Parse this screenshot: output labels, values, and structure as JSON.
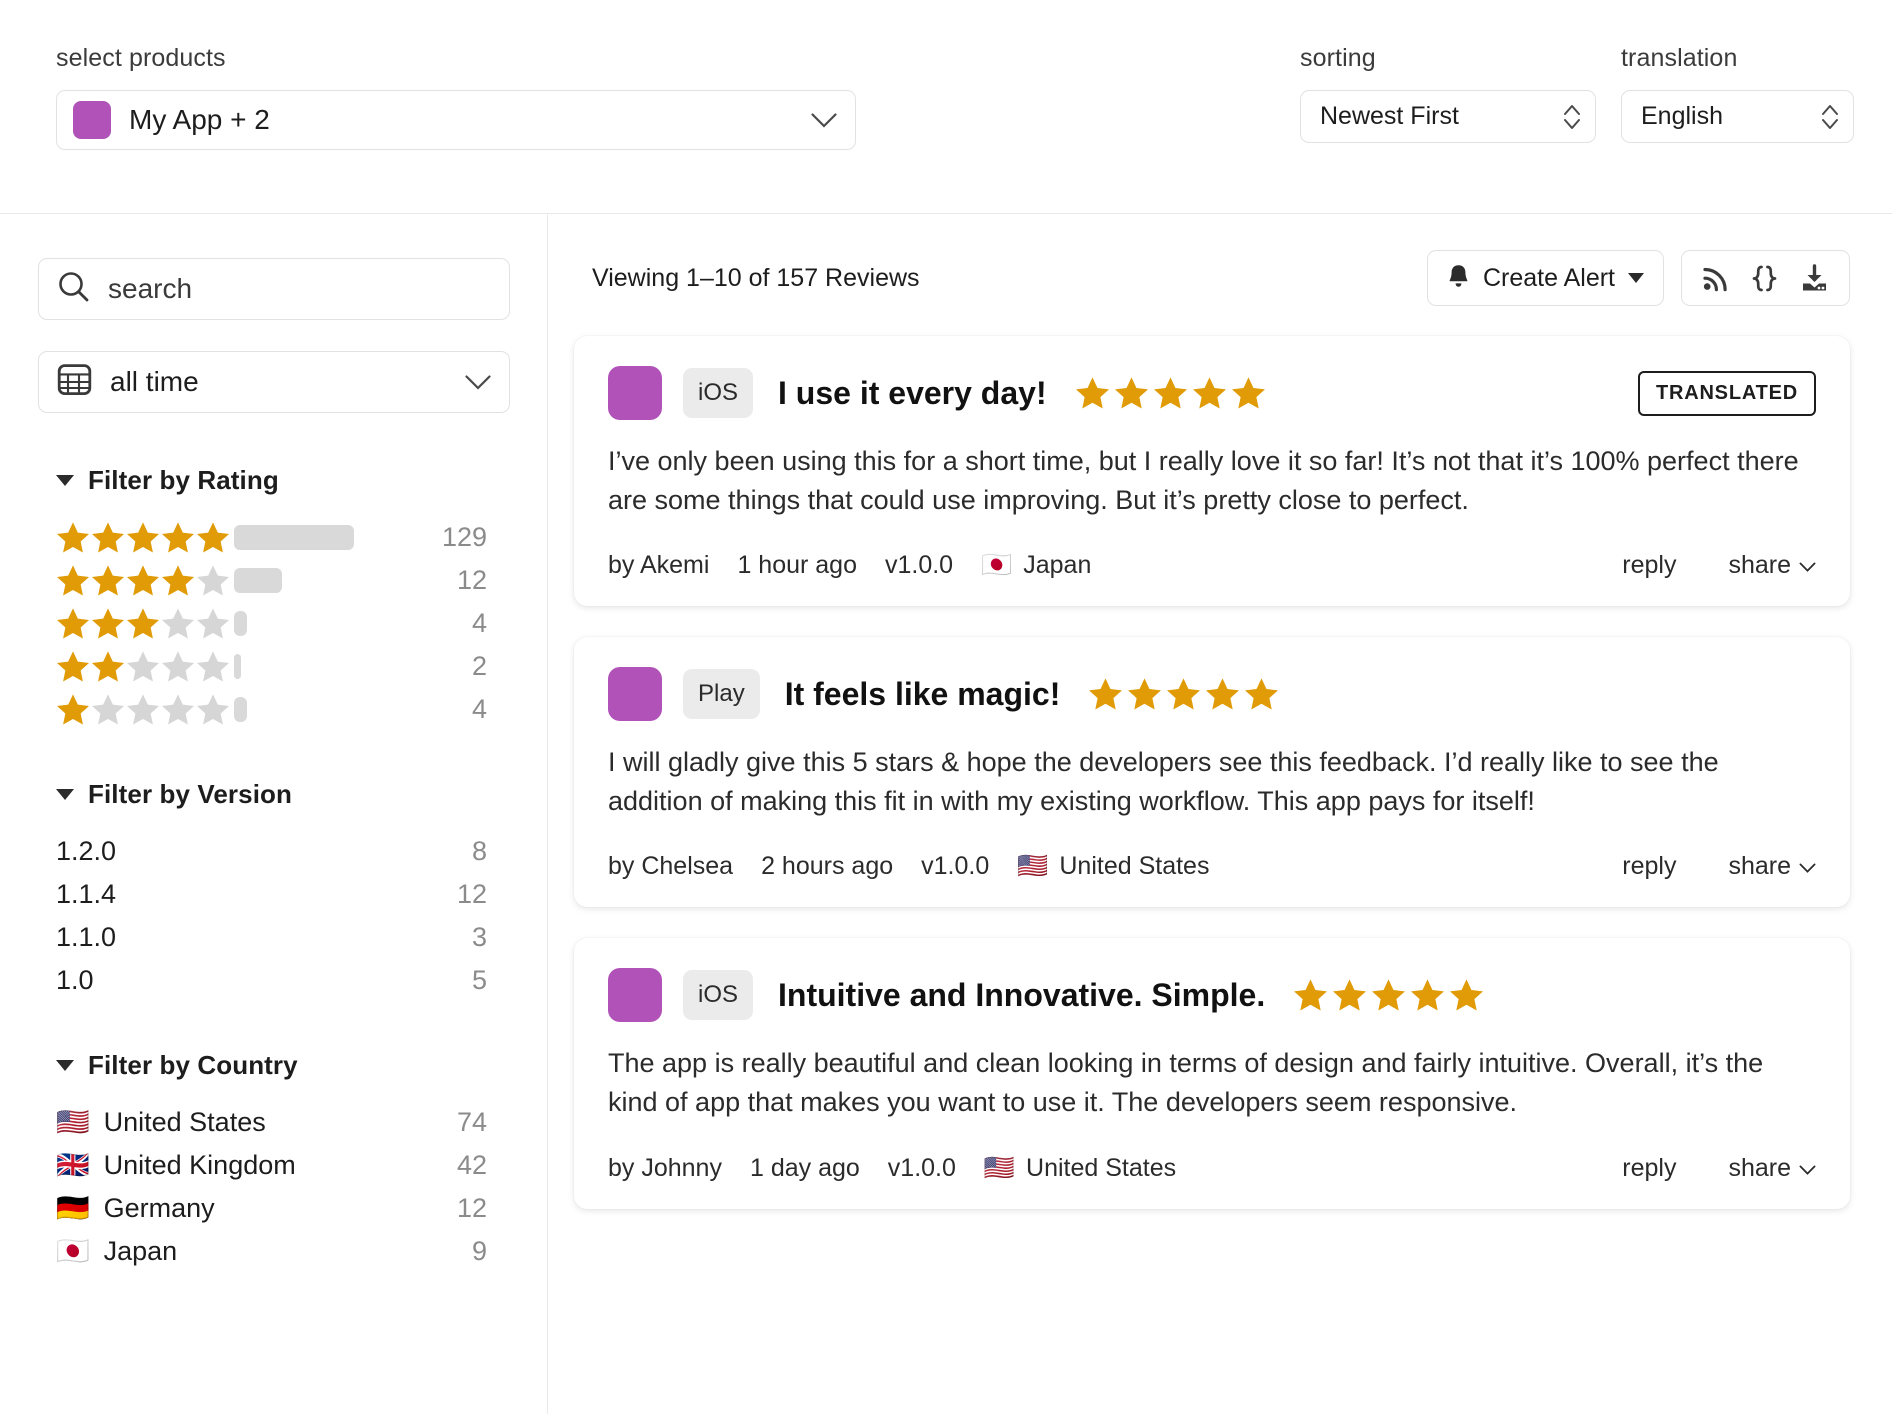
{
  "header": {
    "products_label": "select products",
    "product_value": "My App + 2",
    "sorting_label": "sorting",
    "sorting_value": "Newest First",
    "translation_label": "translation",
    "translation_value": "English"
  },
  "sidebar": {
    "search_placeholder": "search",
    "search_value": "",
    "time_value": "all time",
    "rating_filter": {
      "title": "Filter by Rating",
      "rows": [
        {
          "stars": 5,
          "count": "129",
          "bar_pct": 100
        },
        {
          "stars": 4,
          "count": "12",
          "bar_pct": 40
        },
        {
          "stars": 3,
          "count": "4",
          "bar_pct": 11
        },
        {
          "stars": 2,
          "count": "2",
          "bar_pct": 6
        },
        {
          "stars": 1,
          "count": "4",
          "bar_pct": 11
        }
      ]
    },
    "version_filter": {
      "title": "Filter by Version",
      "rows": [
        {
          "label": "1.2.0",
          "count": "8"
        },
        {
          "label": "1.1.4",
          "count": "12"
        },
        {
          "label": "1.1.0",
          "count": "3"
        },
        {
          "label": "1.0",
          "count": "5"
        }
      ]
    },
    "country_filter": {
      "title": "Filter by Country",
      "rows": [
        {
          "flag": "🇺🇸",
          "label": "United States",
          "count": "74"
        },
        {
          "flag": "🇬🇧",
          "label": "United Kingdom",
          "count": "42"
        },
        {
          "flag": "🇩🇪",
          "label": "Germany",
          "count": "12"
        },
        {
          "flag": "🇯🇵",
          "label": "Japan",
          "count": "9"
        }
      ]
    }
  },
  "main": {
    "viewing_text": "Viewing 1–10 of 157 Reviews",
    "create_alert_label": "Create Alert",
    "reply_label": "reply",
    "share_label": "share",
    "translated_label": "TRANSLATED"
  },
  "reviews": [
    {
      "platform": "iOS",
      "title": "I use it every day!",
      "rating": 5,
      "translated": true,
      "body": "I’ve only been using this for a short time, but I really love it so far! It’s not that it’s 100% perfect there are some things that could use improving. But it’s pretty close to perfect.",
      "author": "by Akemi",
      "time": "1 hour ago",
      "version": "v1.0.0",
      "flag": "🇯🇵",
      "country": "Japan"
    },
    {
      "platform": "Play",
      "title": "It feels like magic!",
      "rating": 5,
      "translated": false,
      "body": "I will gladly give this 5 stars & hope the developers see this feedback. I’d really like to see the addition of making this fit in with my existing workflow. This app pays for itself!",
      "author": "by Chelsea",
      "time": "2 hours ago",
      "version": "v1.0.0",
      "flag": "🇺🇸",
      "country": "United States"
    },
    {
      "platform": "iOS",
      "title": "Intuitive and Innovative. Simple.",
      "rating": 5,
      "translated": false,
      "body": "The app is really beautiful and clean looking in terms of design and fairly intuitive. Overall, it’s the kind of app that makes you want to use it. The developers seem responsive.",
      "author": "by Johnny",
      "time": "1 day ago",
      "version": "v1.0.0",
      "flag": "🇺🇸",
      "country": "United States"
    }
  ],
  "icons": {
    "search": "search-icon",
    "calendar": "calendar-icon",
    "bell": "bell-icon",
    "rss": "rss-icon",
    "json": "json-braces-icon",
    "download": "download-icon"
  },
  "colors": {
    "brand_purple": "#b052b8",
    "star_gold": "#e09b06",
    "star_empty": "#d6d6d6",
    "bar_gray": "#d9d9d9"
  }
}
